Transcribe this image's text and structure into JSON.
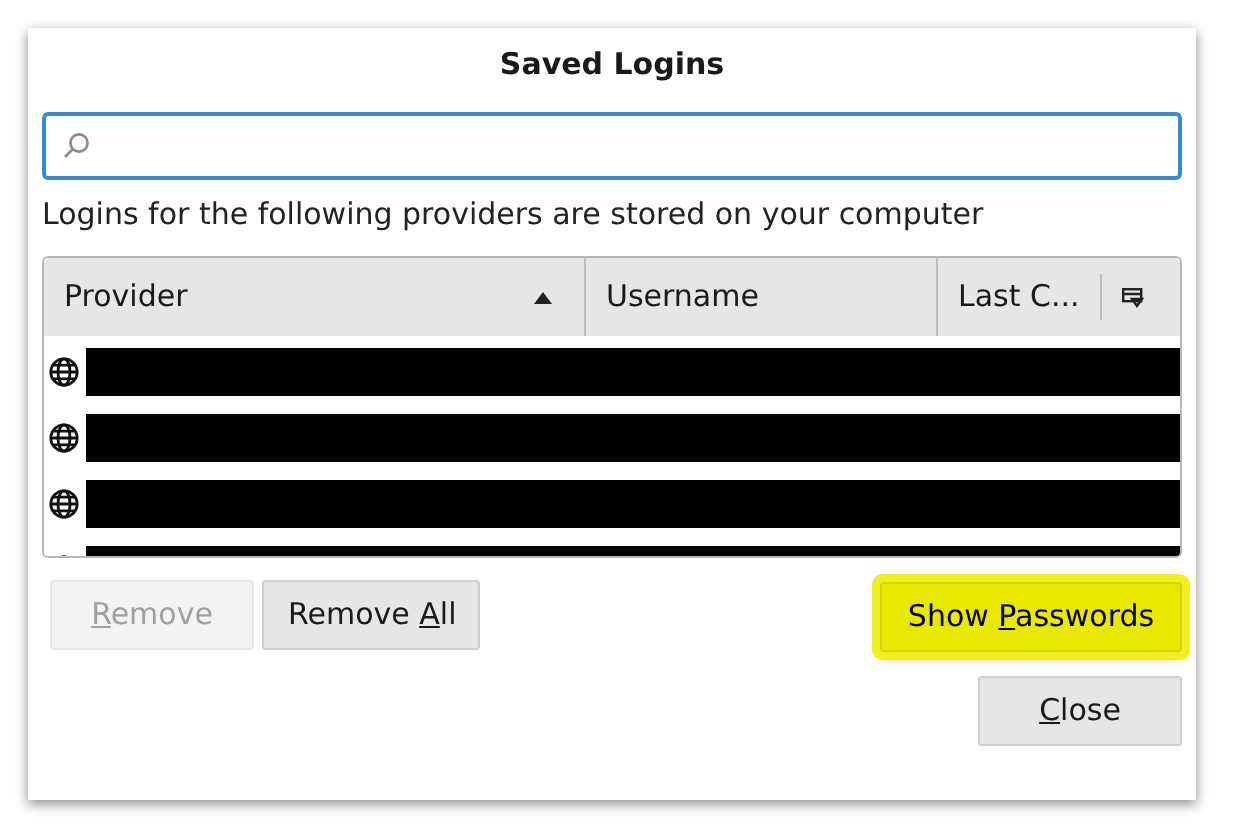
{
  "window": {
    "title": "Saved Logins"
  },
  "description": "Logins for the following providers are stored on your computer",
  "table": {
    "columns": [
      {
        "label": "Provider",
        "sorted": true
      },
      {
        "label": "Username",
        "sorted": false
      },
      {
        "label": "Last C...",
        "sorted": false
      }
    ],
    "rows": [
      {
        "redacted": true
      },
      {
        "redacted": true
      },
      {
        "redacted": true
      },
      {
        "redacted": true
      }
    ]
  },
  "buttons": [
    {
      "label_parts": [
        {
          "text": "R",
          "underlined": true
        },
        {
          "text": "emove",
          "underlined": false
        }
      ],
      "disabled": true,
      "highlighted": false
    },
    {
      "label_parts": [
        {
          "text": "Remove ",
          "underlined": false
        },
        {
          "text": "A",
          "underlined": true
        },
        {
          "text": "ll",
          "underlined": false
        }
      ],
      "disabled": false,
      "highlighted": false
    },
    {
      "label_parts": [
        {
          "text": "Show ",
          "underlined": false
        },
        {
          "text": "P",
          "underlined": true
        },
        {
          "text": "asswords",
          "underlined": false
        }
      ],
      "disabled": false,
      "highlighted": true
    },
    {
      "label_parts": [
        {
          "text": "C",
          "underlined": true
        },
        {
          "text": "lose",
          "underlined": false
        }
      ],
      "disabled": false,
      "highlighted": false
    }
  ]
}
